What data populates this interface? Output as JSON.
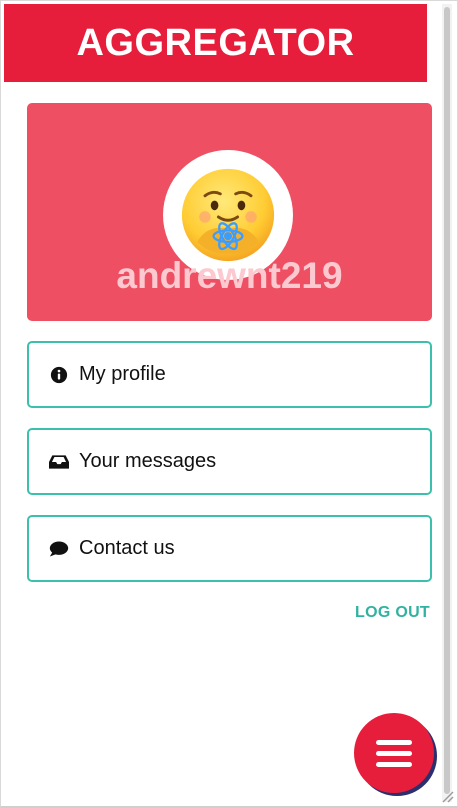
{
  "header": {
    "title": "AGGREGATOR"
  },
  "profile": {
    "username": "andrewnt219",
    "avatar_icon": "care-emoji-react-avatar-icon"
  },
  "menu": [
    {
      "label": "My profile",
      "icon": "info-circle-icon"
    },
    {
      "label": "Your messages",
      "icon": "inbox-icon"
    },
    {
      "label": "Contact us",
      "icon": "comment-icon"
    }
  ],
  "logout_label": "LOG OUT",
  "fab": {
    "icon": "hamburger-menu-icon"
  },
  "colors": {
    "brand": "#e61e3c",
    "card": "#ef4f63",
    "accent": "#3dbfad"
  }
}
